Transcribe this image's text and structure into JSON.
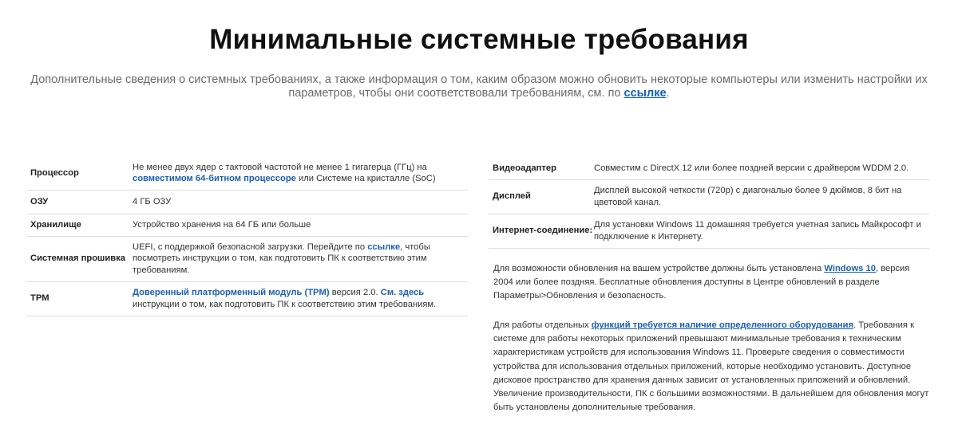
{
  "header": {
    "title": "Минимальные системные требования",
    "subtitle_text": "Дополнительные сведения о системных требованиях, а также информация о том, каким образом можно обновить некоторые компьютеры или изменить настройки их параметров, чтобы они соответствовали требованиям, см. по",
    "subtitle_link": "ссылке",
    "subtitle_end": "."
  },
  "left_table": {
    "processor": {
      "label": "Процессор",
      "text_1": "Не менее двух ядер с тактовой частотой не менее 1 гигагерца (ГГц) на",
      "link": "совместимом 64-битном процессоре",
      "text_2": "или Системе на кристалле (SoC)"
    },
    "ram": {
      "label": "ОЗУ",
      "value": "4 ГБ ОЗУ"
    },
    "storage": {
      "label": "Хранилище",
      "value": "Устройство хранения на 64 ГБ или больше"
    },
    "firmware": {
      "label": "Системная прошивка",
      "text_1": "UEFI, с поддержкой безопасной загрузки. Перейдите по",
      "link": "ссылке",
      "text_2": ", чтобы посмотреть инструкции о том, как подготовить ПК к соответствию этим требованиям."
    },
    "tpm": {
      "label": "TPM",
      "link_1": "Доверенный платформенный модуль (TPM)",
      "text_1": "версия 2.0.",
      "link_2": "См. здесь",
      "text_2": "инструкции о том, как подготовить ПК к соответствию этим требованиям."
    }
  },
  "right_table": {
    "gpu": {
      "label": "Видеоадаптер",
      "value": "Совместим с DirectX 12 или более поздней версии с драйвером WDDM 2.0."
    },
    "display": {
      "label": "Дисплей",
      "value": "Дисплей высокой четкости (720p) с диагональю более 9 дюймов, 8 бит на цветовой канал."
    },
    "internet": {
      "label": "Интернет-соединение:",
      "value": "Для установки Windows 11 домашняя требуется учетная запись Майкрософт и подключение к Интернету."
    }
  },
  "notes": {
    "update": {
      "text_1": "Для возможности обновления на вашем устройстве должны быть установлена",
      "link": "Windows 10",
      "text_2": ", версия 2004 или более поздняя. Бесплатные обновления доступны в Центре обновлений в разделе Параметры>Обновления и безопасность."
    },
    "features": {
      "text_1": "Для работы отдельных",
      "link": "функций требуется наличие определенного оборудования",
      "text_2": ". Требования к системе для работы некоторых приложений превышают минимальные требования к техническим характеристикам устройств для использования Windows 11. Проверьте сведения о совместимости устройства для использования отдельных приложений, которые необходимо установить. Доступное дисковое пространство для хранения данных зависит от установленных приложений и обновлений. Увеличение производительности, ПК с большими возможностями. В дальнейшем для обновления могут быть установлены дополнительные требования."
    }
  }
}
